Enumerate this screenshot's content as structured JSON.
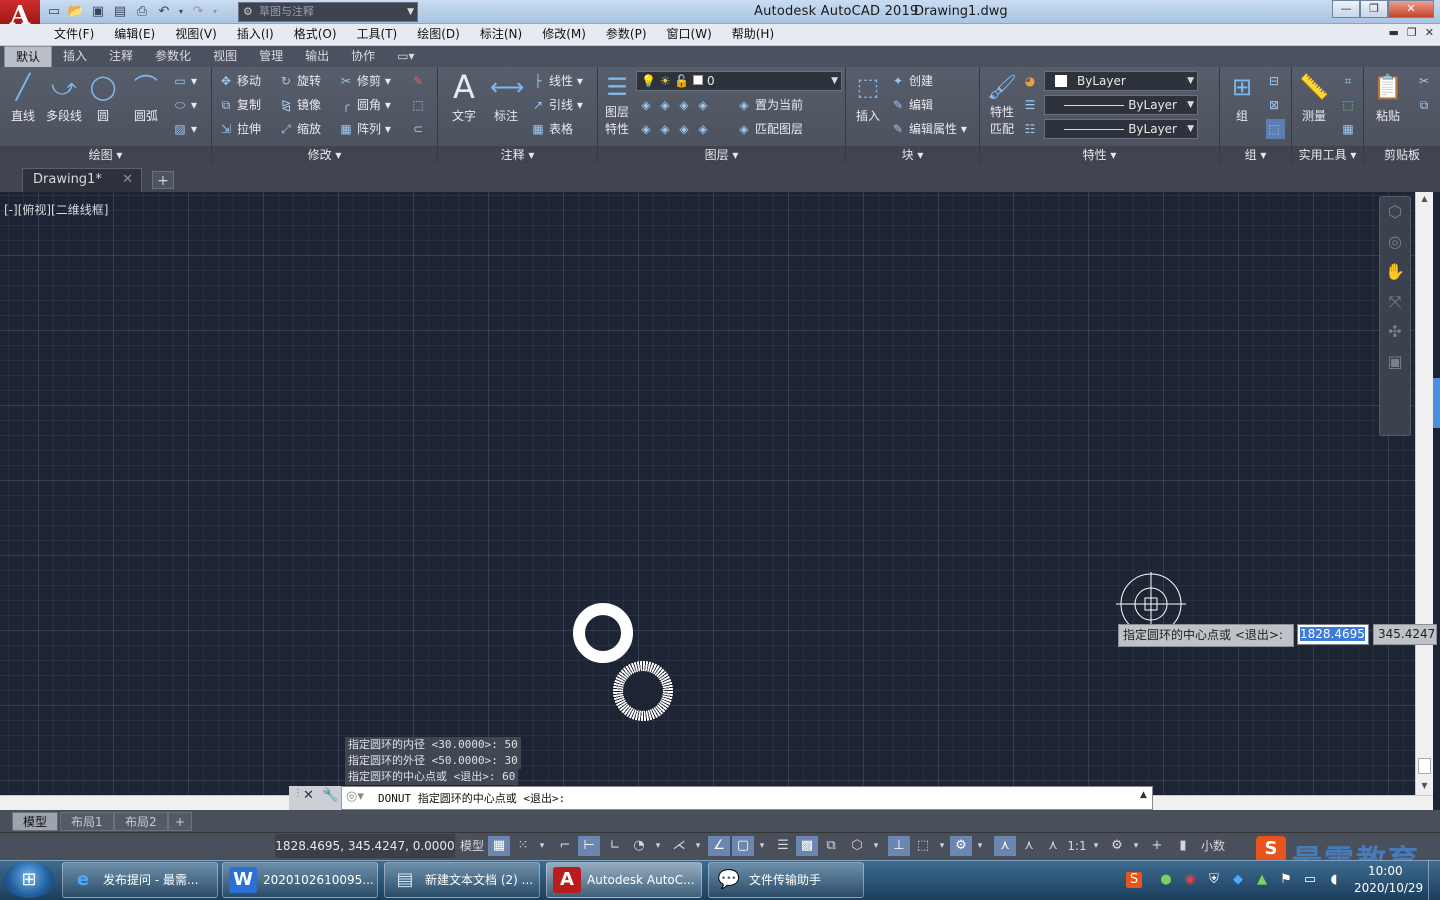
{
  "titlebar": {
    "app_title": "Autodesk AutoCAD 2019",
    "file_name": "Drawing1.dwg",
    "workspace": "草图与注释",
    "app_letter": "A"
  },
  "menubar": [
    "文件(F)",
    "编辑(E)",
    "视图(V)",
    "插入(I)",
    "格式(O)",
    "工具(T)",
    "绘图(D)",
    "标注(N)",
    "修改(M)",
    "参数(P)",
    "窗口(W)",
    "帮助(H)"
  ],
  "ribbon_tabs": [
    "默认",
    "插入",
    "注释",
    "参数化",
    "视图",
    "管理",
    "输出",
    "协作"
  ],
  "ribbon": {
    "draw": {
      "title": "绘图",
      "line": "直线",
      "polyline": "多段线",
      "circle": "圆",
      "arc": "圆弧"
    },
    "modify": {
      "title": "修改",
      "move": "移动",
      "rotate": "旋转",
      "trim": "修剪",
      "copy": "复制",
      "mirror": "镜像",
      "fillet": "圆角",
      "stretch": "拉伸",
      "scale": "缩放",
      "array": "阵列"
    },
    "annotation": {
      "title": "注释",
      "text": "文字",
      "dimension": "标注",
      "linear": "线性",
      "leader": "引线",
      "table": "表格"
    },
    "layers": {
      "title": "图层",
      "properties_l1": "图层",
      "properties_l2": "特性",
      "current_layer": "0",
      "make_current": "置为当前",
      "match_layer": "匹配图层"
    },
    "block": {
      "title": "块",
      "insert": "插入",
      "create": "创建",
      "edit": "编辑",
      "edit_attr": "编辑属性"
    },
    "properties": {
      "title": "特性",
      "match_l1": "特性",
      "match_l2": "匹配",
      "color": "ByLayer",
      "linetype": "ByLayer",
      "lineweight": "ByLayer"
    },
    "groups": {
      "title": "组",
      "group": "组"
    },
    "utilities": {
      "title": "实用工具",
      "measure": "测量"
    },
    "clipboard": {
      "title": "剪贴板",
      "paste": "粘贴"
    }
  },
  "doc_tab": "Drawing1*",
  "viewport_label": "[-][俯视][二维线框]",
  "dynamic_input": {
    "prompt": "指定圆环的中心点或 <退出>:",
    "x": "1828.4695",
    "y": "345.4247"
  },
  "command_history": [
    "指定圆环的内径 <30.0000>: 50",
    "指定圆环的外径 <50.0000>: 30",
    "指定圆环的中心点或 <退出>: 60"
  ],
  "command_line": "DONUT 指定圆环的中心点或 <退出>:",
  "layout_tabs": [
    "模型",
    "布局1",
    "布局2"
  ],
  "status": {
    "coords": "1828.4695, 345.4247, 0.0000",
    "model": "模型",
    "scale": "1:1",
    "units": "小数"
  },
  "taskbar": {
    "items": [
      "发布提问 - 最需...",
      "2020102610095...",
      "新建文本文档 (2) ...",
      "Autodesk AutoC...",
      "文件传输助手"
    ],
    "time": "10:00",
    "date": "2020/10/29"
  },
  "watermark": "最需教育",
  "colors": {
    "canvas": "#1d2433",
    "ribbon": "#4f5562",
    "accent": "#3d7bd9",
    "app_button": "#b81d1d"
  }
}
